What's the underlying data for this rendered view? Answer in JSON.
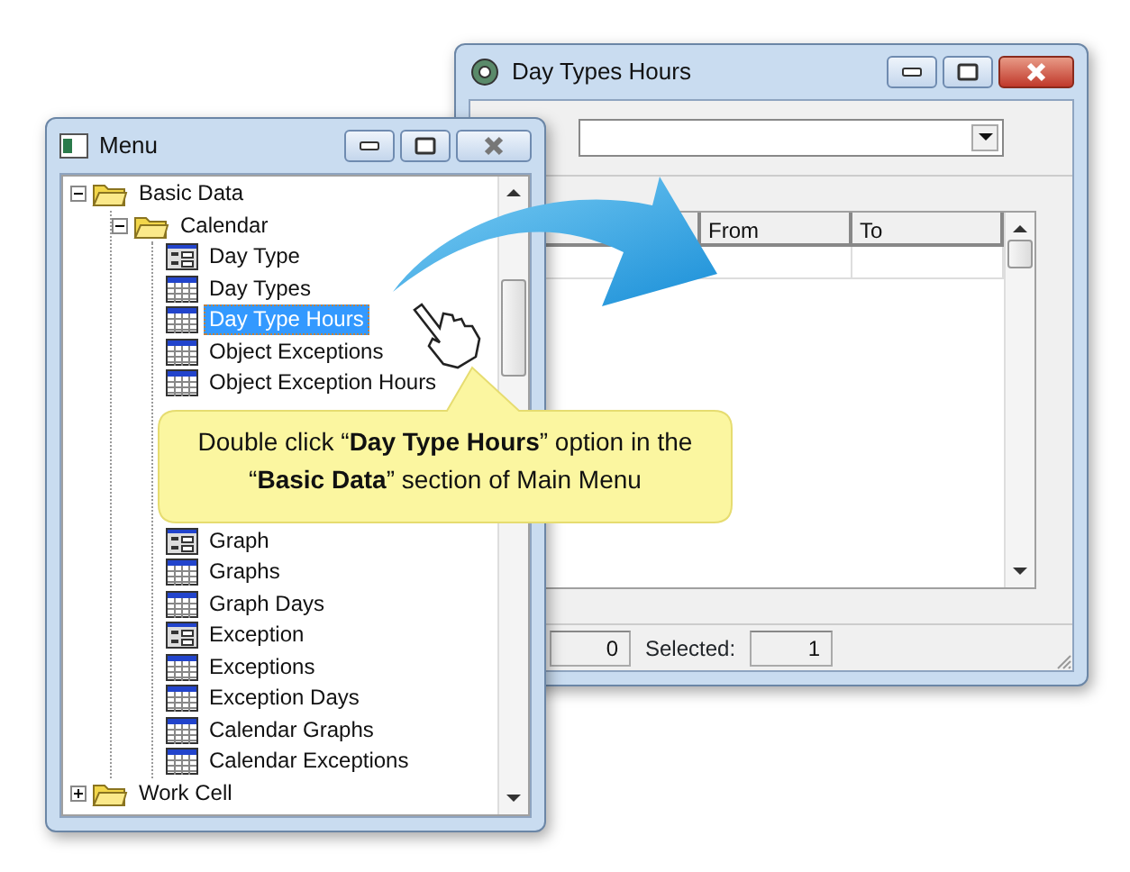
{
  "day_types_window": {
    "title": "Day Types Hours",
    "columns": [
      "From",
      "To"
    ],
    "status_count": "0",
    "selected_label": "Selected:",
    "selected_count": "1"
  },
  "menu_window": {
    "title": "Menu",
    "tree": [
      {
        "label": "Basic Data",
        "kind": "folder",
        "expanded": true,
        "selected": false,
        "children": [
          {
            "label": "Calendar",
            "kind": "folder",
            "expanded": true,
            "selected": false,
            "children": [
              {
                "label": "Day Type",
                "kind": "form",
                "selected": false
              },
              {
                "label": "Day Types",
                "kind": "table",
                "selected": false
              },
              {
                "label": "Day Type Hours",
                "kind": "table",
                "selected": true
              },
              {
                "label": "Object Exceptions",
                "kind": "table",
                "selected": false
              },
              {
                "label": "Object Exception Hours",
                "kind": "table",
                "selected": false
              },
              {
                "kind": "covered"
              },
              {
                "kind": "covered"
              },
              {
                "kind": "covered"
              },
              {
                "kind": "covered"
              },
              {
                "label": "Graph",
                "kind": "form",
                "selected": false
              },
              {
                "label": "Graphs",
                "kind": "table",
                "selected": false
              },
              {
                "label": "Graph Days",
                "kind": "table",
                "selected": false
              },
              {
                "label": "Exception",
                "kind": "form",
                "selected": false
              },
              {
                "label": "Exceptions",
                "kind": "table",
                "selected": false
              },
              {
                "label": "Exception Days",
                "kind": "table",
                "selected": false
              },
              {
                "label": "Calendar Graphs",
                "kind": "table",
                "selected": false
              },
              {
                "label": "Calendar Exceptions",
                "kind": "table",
                "selected": false
              }
            ]
          }
        ]
      },
      {
        "label": "Work Cell",
        "kind": "folder",
        "expanded": false,
        "selected": false
      }
    ]
  },
  "callout": {
    "text": "Double click “**Day Type Hours**” option in the “**Basic Data**” section of Main Menu"
  }
}
